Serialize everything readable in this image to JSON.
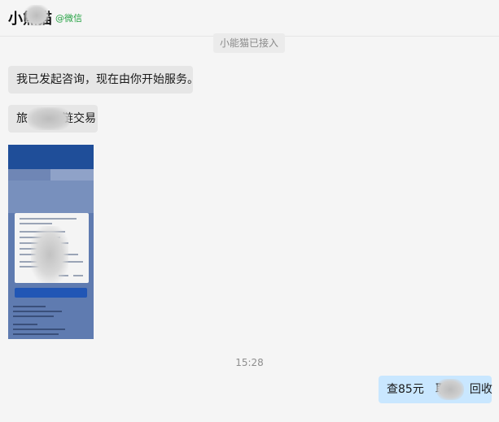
{
  "header": {
    "contact_name": "小熊猫",
    "source_tag": "@微信"
  },
  "messages": {
    "system_notice": "小能猫已接入",
    "m1": "我已发起咨询，现在由你开始服务。",
    "m2": "旅　　　链交易",
    "m3": "查85元　耶　　回收",
    "timestamp": "15:28"
  },
  "image_message": {
    "description_icon": "phone-screenshot-image"
  },
  "colors": {
    "background": "#f5f5f5",
    "incoming_bubble": "#e6e6e6",
    "outgoing_bubble": "#c9e7ff",
    "wechat_tag": "#27a345"
  }
}
